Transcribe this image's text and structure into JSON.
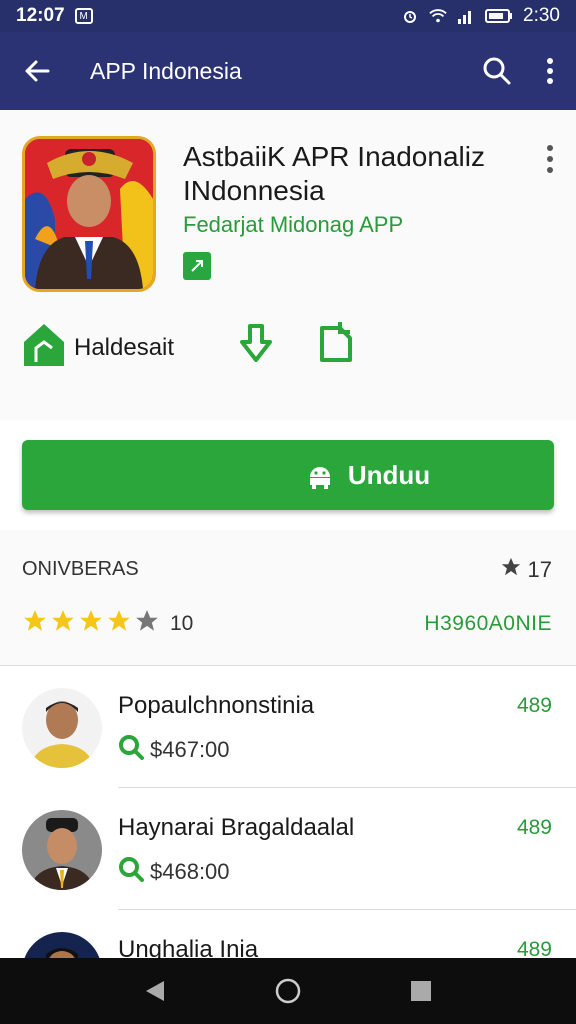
{
  "statusbar": {
    "time": "12:07",
    "notif_icon": "M",
    "battery_time": "2:30"
  },
  "appbar": {
    "title": "APP Indonesia"
  },
  "app": {
    "title": "AstbaiiK APR Inadonaliz INdonnesia",
    "developer": "Fedarjat Midonag APP",
    "badge_icon": "verified-icon"
  },
  "actions": {
    "first_label": "Haldesait"
  },
  "install": {
    "label": "Unduu"
  },
  "rating": {
    "heading": "ONIVBERAS",
    "count": "17",
    "stars": 4,
    "stars_max": 5,
    "reviews": "10",
    "right_label": "H3960A0NIE"
  },
  "list": [
    {
      "name": "Popaulchnonstinia",
      "price": "$467:00",
      "score": "489"
    },
    {
      "name": "Haynarai Bragaldaalal",
      "price": "$468:00",
      "score": "489"
    },
    {
      "name": "Unghalia Inia",
      "price": "",
      "score": "489"
    }
  ],
  "colors": {
    "primary": "#2b3375",
    "accent": "#2aa63a",
    "star": "#f5c518"
  }
}
